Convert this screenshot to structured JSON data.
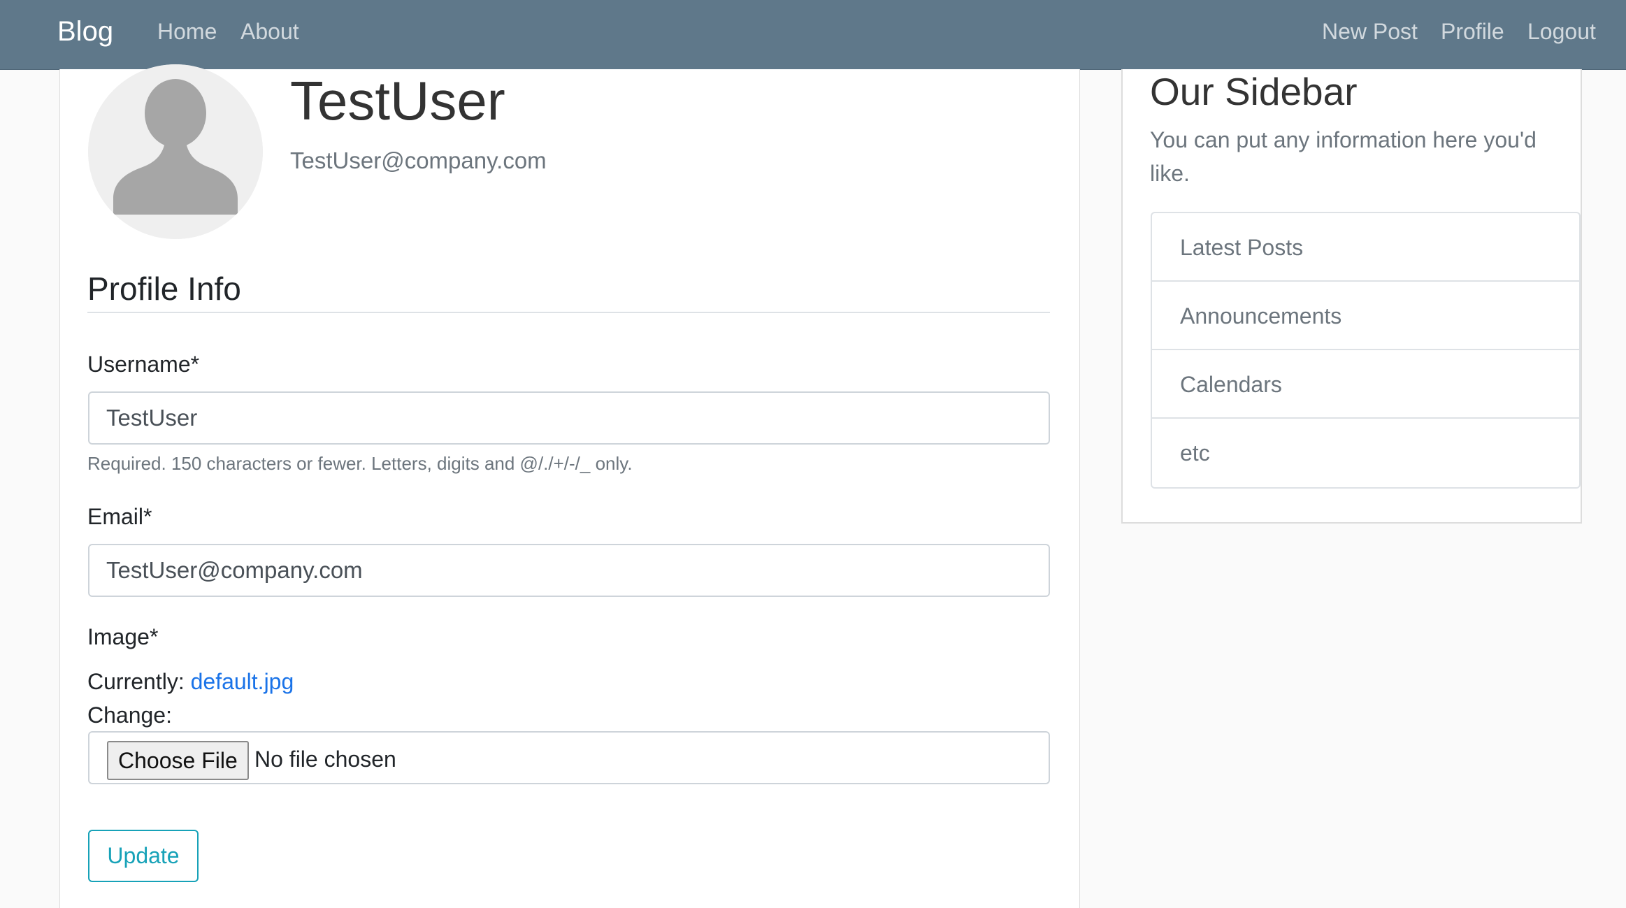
{
  "navbar": {
    "brand": "Blog",
    "left_links": [
      "Home",
      "About"
    ],
    "right_links": [
      "New Post",
      "Profile",
      "Logout"
    ]
  },
  "profile": {
    "username": "TestUser",
    "email": "TestUser@company.com",
    "avatar_icon": "user-silhouette-icon"
  },
  "form": {
    "section_title": "Profile Info",
    "username_label": "Username*",
    "username_value": "TestUser",
    "username_help": "Required. 150 characters or fewer. Letters, digits and @/./+/-/_ only.",
    "email_label": "Email*",
    "email_value": "TestUser@company.com",
    "image_label": "Image*",
    "currently_label": "Currently:",
    "current_file": "default.jpg",
    "change_label": "Change:",
    "choose_file_label": "Choose File",
    "no_file_text": "No file chosen",
    "submit_label": "Update"
  },
  "sidebar": {
    "title": "Our Sidebar",
    "text": "You can put any information here you'd like.",
    "items": [
      "Latest Posts",
      "Announcements",
      "Calendars",
      "etc"
    ]
  },
  "colors": {
    "navbar_bg": "#5f788a",
    "link": "#1a73e8",
    "button_accent": "#17a2b8"
  }
}
